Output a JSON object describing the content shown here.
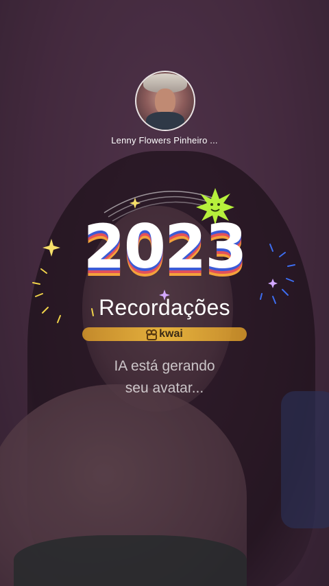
{
  "profile": {
    "username": "Lenny Flowers Pinheiro ..."
  },
  "badge": {
    "year": "2023",
    "subtitle": "Recordações",
    "brand": "kwai"
  },
  "status": {
    "line1": "IA está gerando",
    "line2": "seu avatar..."
  },
  "colors": {
    "stripe_blue": "#3b5bd6",
    "stripe_red": "#e2515a",
    "stripe_orange": "#f3a23b",
    "sun_green": "#b6f03c",
    "brand_bar": "#f0b43a"
  },
  "icons": [
    "sparkle-icon",
    "smiley-sun-icon",
    "kwai-logo-icon"
  ]
}
